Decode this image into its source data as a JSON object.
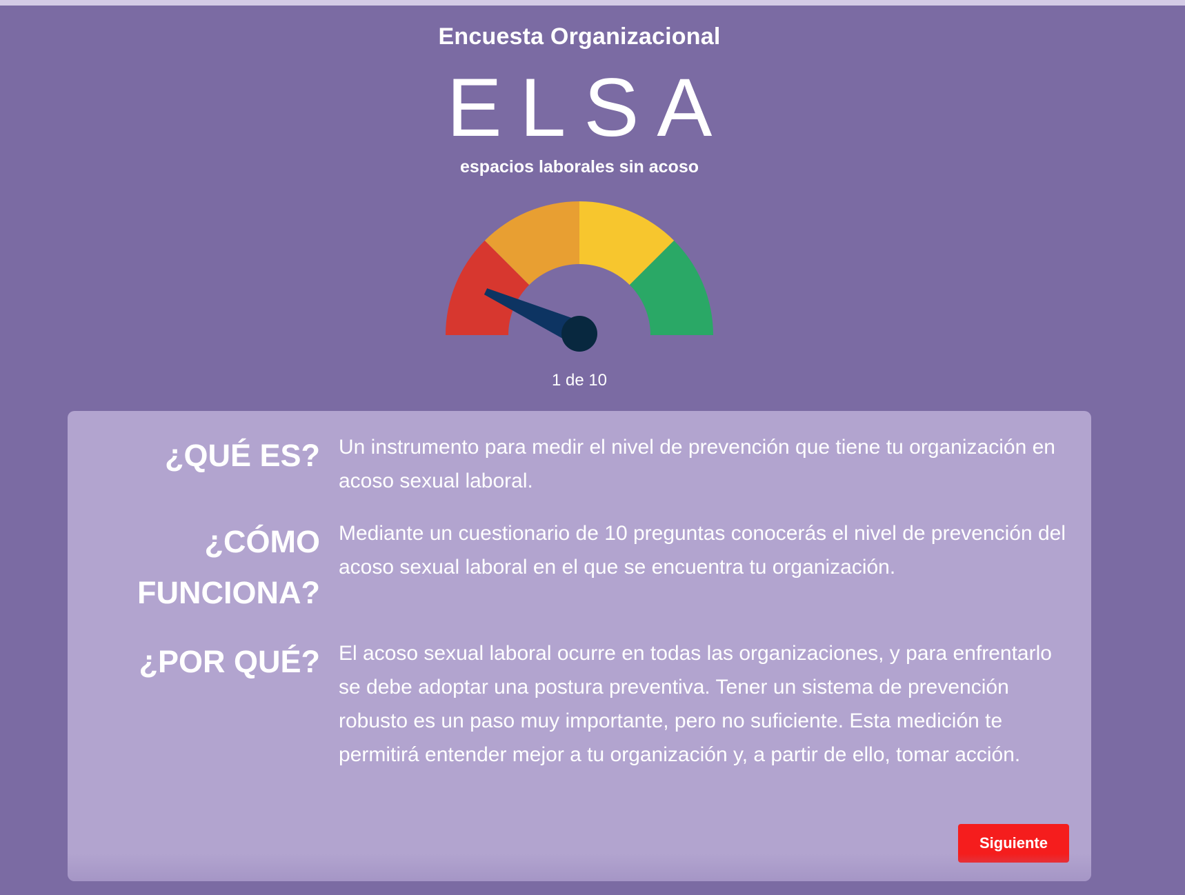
{
  "header": {
    "title": "Encuesta Organizacional"
  },
  "logo": {
    "word": "ELSA",
    "tagline": "espacios laborales sin acoso"
  },
  "gauge": {
    "segments": [
      {
        "name": "red",
        "color": "#d7372f"
      },
      {
        "name": "orange",
        "color": "#e89f32"
      },
      {
        "name": "yellow",
        "color": "#f7c62e"
      },
      {
        "name": "green",
        "color": "#2aa866"
      }
    ],
    "needle_color": "#0d3462",
    "hub_color": "#08283f",
    "level": 0.1
  },
  "progress": {
    "text": "1 de 10"
  },
  "sections": [
    {
      "label": "¿QUÉ ES?",
      "text": "Un instrumento para medir el nivel de prevención que tiene tu organización en acoso sexual laboral."
    },
    {
      "label": "¿CÓMO FUNCIONA?",
      "text": "Mediante un cuestionario de 10 preguntas conocerás el nivel de prevención del acoso sexual laboral en el que se encuentra tu organización."
    },
    {
      "label": "¿POR QUÉ?",
      "text": "El acoso sexual laboral ocurre en todas las organizaciones, y para enfrentarlo se debe adoptar una postura preventiva. Tener un sistema de prevención robusto es un paso muy importante, pero no suficiente. Esta medición te permitirá entender mejor a tu organización y, a partir de ello, tomar acción."
    }
  ],
  "actions": {
    "next_label": "Siguiente",
    "next_color": "#f51d1d"
  },
  "colors": {
    "background": "#7b6ba3",
    "card": "#b2a4cf"
  }
}
